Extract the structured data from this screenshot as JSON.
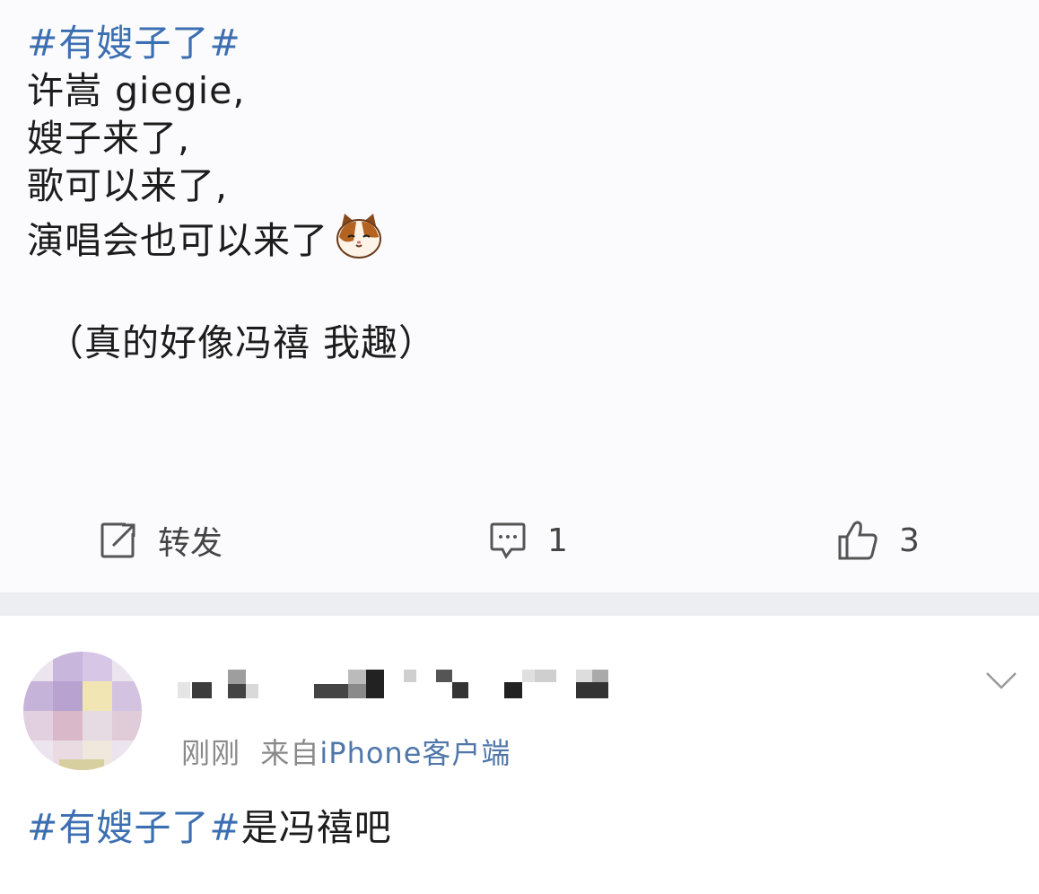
{
  "post": {
    "topic": "#有嫂子了#",
    "lines": [
      "许嵩 giegie,",
      "嫂子来了,",
      "歌可以来了,",
      "演唱会也可以来了"
    ],
    "quote": "（真的好像冯禧 我趣）",
    "emoji_icon": "cat-face-emoji"
  },
  "actions": {
    "repost_label": "转发",
    "comment_count": "1",
    "like_count": "3"
  },
  "comment": {
    "time": "刚刚",
    "source": "来自",
    "client": "iPhone客户端",
    "topic": "#有嫂子了#",
    "text": "是冯禧吧"
  }
}
